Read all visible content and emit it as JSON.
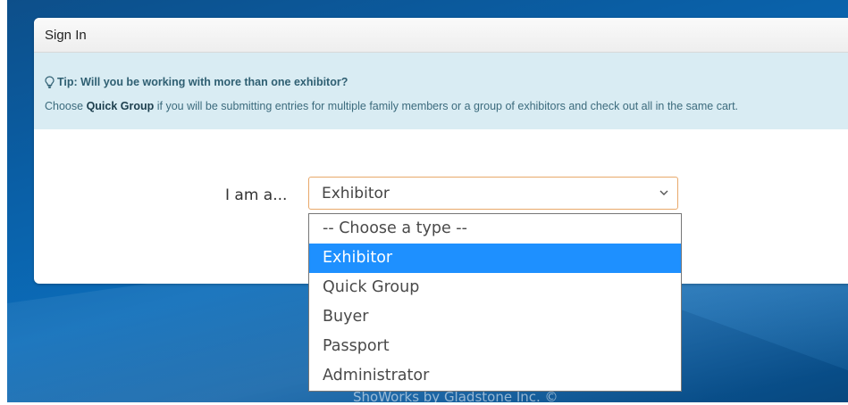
{
  "card": {
    "title": "Sign In"
  },
  "tip": {
    "title": "Tip: Will you be working with more than one exhibitor?",
    "body_prefix": "Choose ",
    "body_bold": "Quick Group",
    "body_suffix": " if you will be submitting entries for multiple family members or a group of exhibitors and check out all in the same cart."
  },
  "form": {
    "label": "I am a...",
    "selected_value": "Exhibitor",
    "options": [
      "-- Choose a type --",
      "Exhibitor",
      "Quick Group",
      "Buyer",
      "Passport",
      "Administrator"
    ],
    "selected_index": 1
  },
  "footer": {
    "text": "ShoWorks by Gladstone Inc. ©"
  },
  "colors": {
    "accent_selected": "#1e90ff",
    "tip_background": "#d9ecf3",
    "select_border": "#e8a86a"
  }
}
